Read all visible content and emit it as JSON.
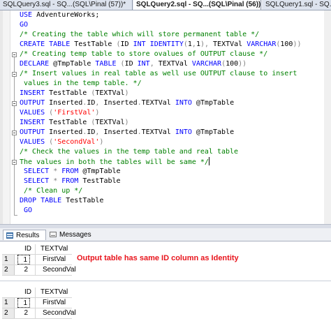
{
  "tabs": [
    {
      "label": "SQLQuery3.sql - SQ...(SQL\\Pinal (57))*",
      "active": false
    },
    {
      "label": "SQLQuery2.sql - SQ...(SQL\\Pinal (56))*",
      "active": true
    },
    {
      "label": "SQLQuery1.sql - SQ...",
      "active": false
    }
  ],
  "tab_close_glyph": "×",
  "editor": {
    "lines": [
      [
        [
          "kw",
          "USE"
        ],
        [
          "txt",
          " AdventureWorks;"
        ]
      ],
      [
        [
          "kw",
          "GO"
        ]
      ],
      [
        [
          "cmt",
          "/* Creating the table which will store permanent table */"
        ]
      ],
      [
        [
          "kw",
          "CREATE TABLE"
        ],
        [
          "txt",
          " TestTable "
        ],
        [
          "gr",
          "("
        ],
        [
          "txt",
          "ID "
        ],
        [
          "kw",
          "INT"
        ],
        [
          "txt",
          " "
        ],
        [
          "kw",
          "IDENTITY"
        ],
        [
          "gr",
          "("
        ],
        [
          "txt",
          "1"
        ],
        [
          "gr",
          ","
        ],
        [
          "txt",
          "1"
        ],
        [
          "gr",
          "),"
        ],
        [
          "txt",
          " TEXTVal "
        ],
        [
          "kw",
          "VARCHAR"
        ],
        [
          "gr",
          "("
        ],
        [
          "txt",
          "100"
        ],
        [
          "gr",
          "))"
        ]
      ],
      [
        [
          "cmt",
          "/* Creating temp table to store ovalues of OUTPUT clause */"
        ]
      ],
      [
        [
          "kw",
          "DECLARE"
        ],
        [
          "txt",
          " @TmpTable "
        ],
        [
          "kw",
          "TABLE"
        ],
        [
          "txt",
          " "
        ],
        [
          "gr",
          "("
        ],
        [
          "txt",
          "ID "
        ],
        [
          "kw",
          "INT"
        ],
        [
          "gr",
          ","
        ],
        [
          "txt",
          " TEXTVal "
        ],
        [
          "kw",
          "VARCHAR"
        ],
        [
          "gr",
          "("
        ],
        [
          "txt",
          "100"
        ],
        [
          "gr",
          "))"
        ]
      ],
      [
        [
          "cmt",
          "/* Insert values in real table as well use OUTPUT clause to insert"
        ]
      ],
      [
        [
          "cmt",
          " values in the temp table. */"
        ]
      ],
      [
        [
          "kw",
          "INSERT"
        ],
        [
          "txt",
          " TestTable "
        ],
        [
          "gr",
          "("
        ],
        [
          "txt",
          "TEXTVal"
        ],
        [
          "gr",
          ")"
        ]
      ],
      [
        [
          "kw",
          "OUTPUT"
        ],
        [
          "txt",
          " Inserted"
        ],
        [
          "gr",
          "."
        ],
        [
          "txt",
          "ID"
        ],
        [
          "gr",
          ","
        ],
        [
          "txt",
          " Inserted"
        ],
        [
          "gr",
          "."
        ],
        [
          "txt",
          "TEXTVal "
        ],
        [
          "kw",
          "INTO"
        ],
        [
          "txt",
          " @TmpTable"
        ]
      ],
      [
        [
          "kw",
          "VALUES"
        ],
        [
          "txt",
          " "
        ],
        [
          "gr",
          "("
        ],
        [
          "str",
          "'FirstVal'"
        ],
        [
          "gr",
          ")"
        ]
      ],
      [
        [
          "kw",
          "INSERT"
        ],
        [
          "txt",
          " TestTable "
        ],
        [
          "gr",
          "("
        ],
        [
          "txt",
          "TEXTVal"
        ],
        [
          "gr",
          ")"
        ]
      ],
      [
        [
          "kw",
          "OUTPUT"
        ],
        [
          "txt",
          " Inserted"
        ],
        [
          "gr",
          "."
        ],
        [
          "txt",
          "ID"
        ],
        [
          "gr",
          ","
        ],
        [
          "txt",
          " Inserted"
        ],
        [
          "gr",
          "."
        ],
        [
          "txt",
          "TEXTVal "
        ],
        [
          "kw",
          "INTO"
        ],
        [
          "txt",
          " @TmpTable"
        ]
      ],
      [
        [
          "kw",
          "VALUES"
        ],
        [
          "txt",
          " "
        ],
        [
          "gr",
          "("
        ],
        [
          "str",
          "'SecondVal'"
        ],
        [
          "gr",
          ")"
        ]
      ],
      [
        [
          "cmt",
          "/* Check the values in the temp table and real table"
        ]
      ],
      [
        [
          "cmt",
          "The values in both the tables will be same */"
        ]
      ],
      [
        [
          "txt",
          " "
        ],
        [
          "kw",
          "SELECT"
        ],
        [
          "txt",
          " "
        ],
        [
          "gr",
          "*"
        ],
        [
          "txt",
          " "
        ],
        [
          "kw",
          "FROM"
        ],
        [
          "txt",
          " @TmpTable"
        ]
      ],
      [
        [
          "txt",
          " "
        ],
        [
          "kw",
          "SELECT"
        ],
        [
          "txt",
          " "
        ],
        [
          "gr",
          "*"
        ],
        [
          "txt",
          " "
        ],
        [
          "kw",
          "FROM"
        ],
        [
          "txt",
          " TestTable"
        ]
      ],
      [
        [
          "txt",
          " "
        ],
        [
          "cmt",
          "/* Clean up */"
        ]
      ],
      [
        [
          "kw",
          "DROP TABLE"
        ],
        [
          "txt",
          " TestTable"
        ]
      ],
      [
        [
          "txt",
          " "
        ],
        [
          "kw",
          "GO"
        ]
      ]
    ]
  },
  "results_tabs": {
    "results_label": "Results",
    "messages_label": "Messages"
  },
  "grid1": {
    "columns": [
      "ID",
      "TEXTVal"
    ],
    "rows": [
      {
        "num": "1",
        "id": "1",
        "val": "FirstVal"
      },
      {
        "num": "2",
        "id": "2",
        "val": "SecondVal"
      }
    ]
  },
  "grid2": {
    "columns": [
      "ID",
      "TEXTVal"
    ],
    "rows": [
      {
        "num": "1",
        "id": "1",
        "val": "FirstVal"
      },
      {
        "num": "2",
        "id": "2",
        "val": "SecondVal"
      }
    ]
  },
  "annotation": "Output table has same ID column as Identity",
  "colors": {
    "keyword": "#0000ff",
    "comment": "#008000",
    "string": "#ff0000",
    "operator": "#808080",
    "annotation": "#e8141c"
  }
}
